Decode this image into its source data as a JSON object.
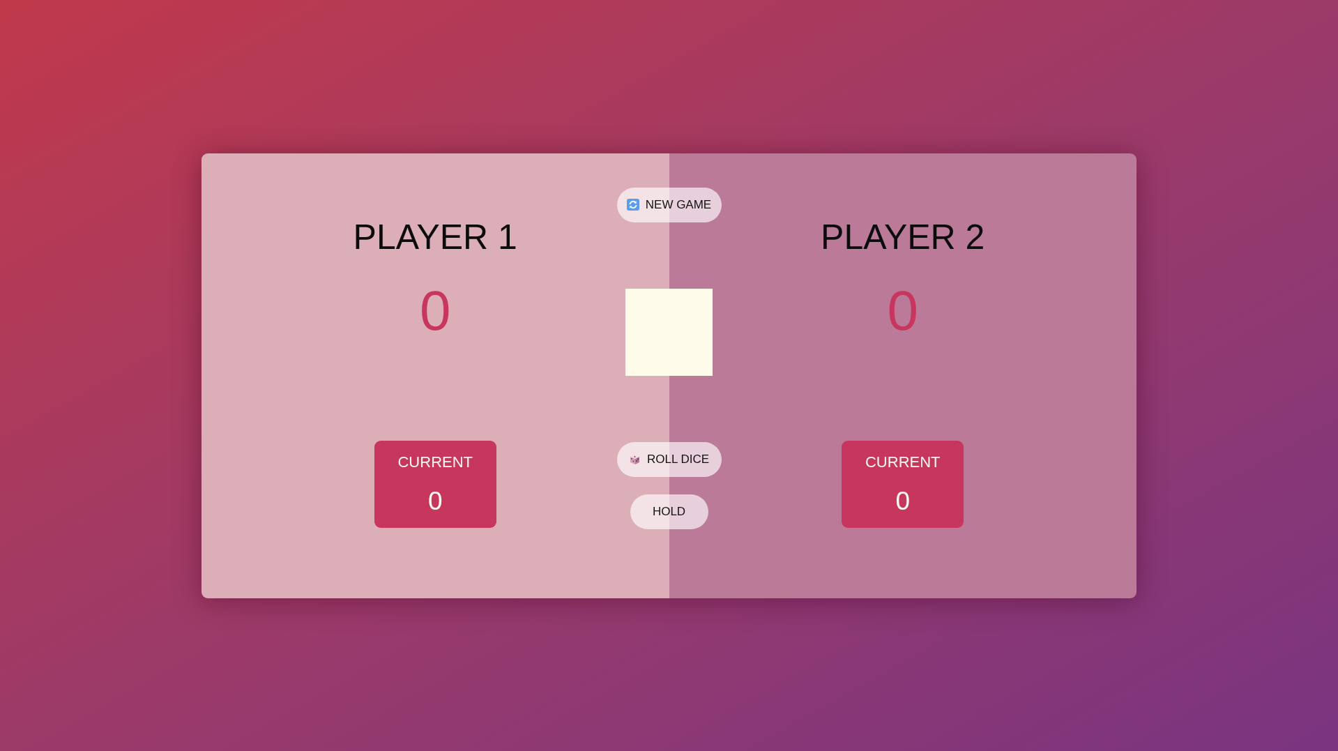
{
  "players": [
    {
      "name": "PLAYER 1",
      "score": "0",
      "current_label": "CURRENT",
      "current_score": "0",
      "active": true
    },
    {
      "name": "PLAYER 2",
      "score": "0",
      "current_label": "CURRENT",
      "current_score": "0",
      "active": false
    }
  ],
  "buttons": [
    {
      "kind": "new",
      "label": "NEW GAME"
    },
    {
      "kind": "roll",
      "label": "ROLL DICE"
    },
    {
      "kind": "hold",
      "label": "HOLD"
    }
  ]
}
